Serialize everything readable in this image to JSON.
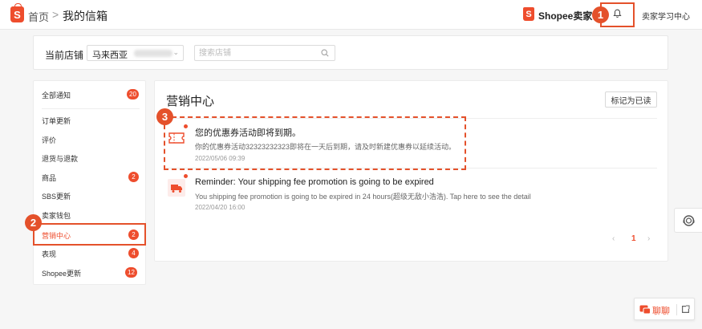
{
  "header": {
    "logo_letter": "S",
    "breadcrumb_home": "首页",
    "breadcrumb_separator": ">",
    "breadcrumb_current": "我的信箱",
    "seller_brand": "Shopee卖家",
    "learning_center": "卖家学习中心"
  },
  "steps": {
    "one": "1",
    "two": "2",
    "three": "3"
  },
  "shop": {
    "label": "当前店铺",
    "selected": "马来西亚",
    "search_placeholder": "搜索店铺"
  },
  "sidebar": {
    "items": [
      {
        "label": "全部通知",
        "badge": "20"
      },
      {
        "label": "订单更新",
        "badge": ""
      },
      {
        "label": "评价",
        "badge": ""
      },
      {
        "label": "退货与退款",
        "badge": ""
      },
      {
        "label": "商品",
        "badge": "2"
      },
      {
        "label": "SBS更新",
        "badge": ""
      },
      {
        "label": "卖家钱包",
        "badge": ""
      },
      {
        "label": "营销中心",
        "badge": "2"
      },
      {
        "label": "表现",
        "badge": "4"
      },
      {
        "label": "Shopee更新",
        "badge": "12"
      }
    ]
  },
  "main": {
    "title": "营销中心",
    "mark_all_read": "标记为已读",
    "notifications": [
      {
        "icon": "voucher-icon",
        "title": "您的优惠券活动即将到期。",
        "body": "你的优惠券活动32323232323即将在一天后到期，请及时新建优惠券以延续活动。",
        "date": "2022/05/06 09:39"
      },
      {
        "icon": "delivery-truck-icon",
        "title": "Reminder: Your shipping fee promotion is going to be expired",
        "body": "You shipping fee promotion is going to be expired in 24 hours(超级无敌小浩浩). Tap here to see the detail",
        "date": "2022/04/20 16:00"
      }
    ],
    "pagination": {
      "prev": "‹",
      "current": "1",
      "next": "›"
    }
  },
  "chat": {
    "label": "聊聊"
  },
  "colors": {
    "brand": "#ee4d2d",
    "annotation": "#e4512b"
  }
}
